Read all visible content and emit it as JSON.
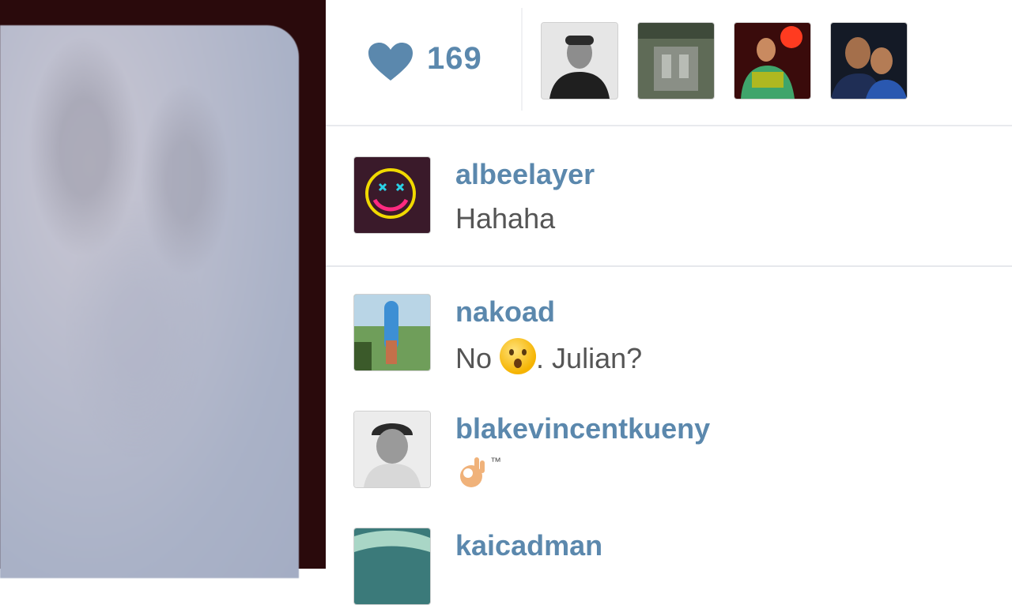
{
  "likes": {
    "count": "169",
    "heart_color": "#5b88ad",
    "icon": "heart-icon"
  },
  "comments": [
    {
      "username": "albeelayer",
      "text": "Hahaha"
    },
    {
      "username": "nakoad",
      "text_before": "No",
      "emoji": "surprised-face-emoji",
      "text_after": ". Julian?"
    },
    {
      "username": "blakevincentkueny",
      "emoji": "ok-hand-emoji",
      "text_after": "™"
    },
    {
      "username": "kaicadman",
      "text": ""
    }
  ],
  "colors": {
    "username": "#5b88ad",
    "comment_text": "#555555",
    "photo_frame": "#2a0a0c"
  }
}
